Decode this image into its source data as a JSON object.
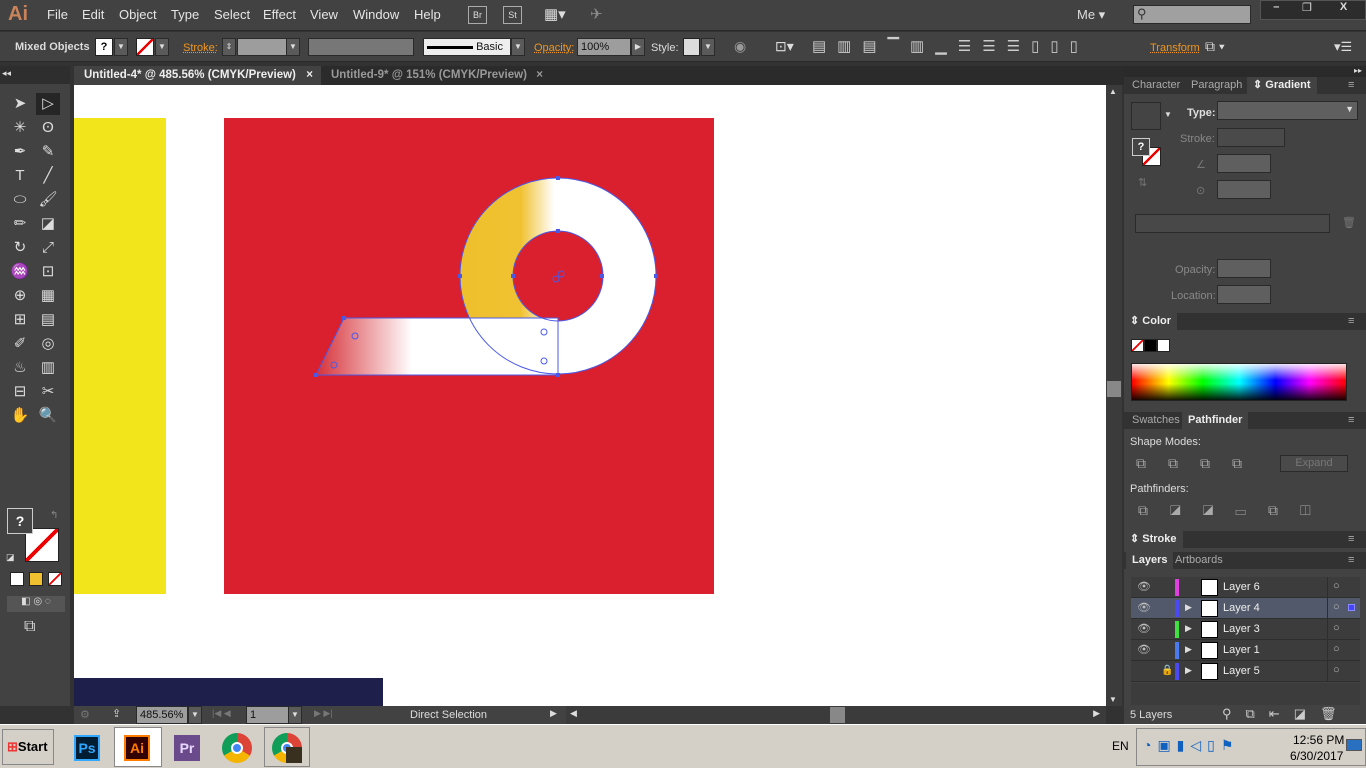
{
  "app": {
    "logo": "Ai",
    "menus": [
      "File",
      "Edit",
      "Object",
      "Type",
      "Select",
      "Effect",
      "View",
      "Window",
      "Help"
    ],
    "bridge": "Br",
    "stock": "St",
    "user": "Me",
    "search_placeholder": ""
  },
  "window_controls": {
    "minimize": "–",
    "restore": "❐",
    "close": "X"
  },
  "control_bar": {
    "selection": "Mixed Objects",
    "fill": "?",
    "stroke_label": "Stroke:",
    "brush": "Basic",
    "opacity_label": "Opacity:",
    "opacity": "100%",
    "style_label": "Style:",
    "transform": "Transform"
  },
  "tabs": [
    {
      "label": "Untitled-4* @ 485.56% (CMYK/Preview)",
      "active": true
    },
    {
      "label": "Untitled-9* @ 151% (CMYK/Preview)",
      "active": false
    }
  ],
  "tools": [
    "selection-tool",
    "direct-selection-tool",
    "magic-wand-tool",
    "lasso-tool",
    "pen-tool",
    "curvature-tool",
    "type-tool",
    "line-tool",
    "ellipse-tool",
    "paintbrush-tool",
    "pencil-tool",
    "eraser-tool",
    "rotate-tool",
    "scale-tool",
    "warp-tool",
    "free-transform-tool",
    "shape-builder-tool",
    "perspective-grid-tool",
    "mesh-tool",
    "gradient-tool",
    "eyedropper-tool",
    "blend-tool",
    "symbol-sprayer-tool",
    "column-graph-tool",
    "artboard-tool",
    "slice-tool",
    "hand-tool",
    "zoom-tool"
  ],
  "tool_glyphs": [
    "➤",
    "▷",
    "✳",
    "ʘ",
    "✒",
    "✎",
    "T",
    "╱",
    "⬭",
    "🖌",
    "✏",
    "◪",
    "↻",
    "⤢",
    "♒",
    "⊡",
    "⊕",
    "▦",
    "⊞",
    "▤",
    "✐",
    "◎",
    "♨",
    "▥",
    "⊟",
    "✂",
    "✋",
    "🔍"
  ],
  "status": {
    "zoom": "485.56%",
    "artboard": "1",
    "tool": "Direct Selection"
  },
  "panels": {
    "top_tabs": [
      "Character",
      "Paragraph",
      "Gradient"
    ],
    "gradient": {
      "type_label": "Type:",
      "stroke_label": "Stroke:",
      "opacity_label": "Opacity:",
      "location_label": "Location:",
      "fill": "?"
    },
    "color": {
      "title": "Color"
    },
    "mid_tabs": [
      "Swatches",
      "Pathfinder"
    ],
    "pathfinder": {
      "shape_modes": "Shape Modes:",
      "expand": "Expand",
      "pathfinders": "Pathfinders:"
    },
    "stroke": {
      "title": "Stroke"
    },
    "layer_tabs": [
      "Layers",
      "Artboards"
    ],
    "layers": [
      {
        "name": "Layer 6",
        "visible": true,
        "locked": false,
        "color": "#e040e0",
        "expandable": false,
        "selected": false
      },
      {
        "name": "Layer 4",
        "visible": true,
        "locked": false,
        "color": "#4a4af0",
        "expandable": true,
        "selected": true
      },
      {
        "name": "Layer 3",
        "visible": true,
        "locked": false,
        "color": "#40e040",
        "expandable": true,
        "selected": false
      },
      {
        "name": "Layer 1",
        "visible": true,
        "locked": false,
        "color": "#4a7af0",
        "expandable": true,
        "selected": false
      },
      {
        "name": "Layer 5",
        "visible": false,
        "locked": true,
        "color": "#4a4af0",
        "expandable": true,
        "selected": false
      }
    ],
    "layer_count": "5 Layers"
  },
  "taskbar": {
    "start": "Start",
    "apps": [
      "Ps",
      "Ai",
      "Pr",
      "Chrome",
      "Chrome"
    ],
    "lang": "EN",
    "time": "12:56 PM",
    "date": "6/30/2017"
  },
  "colors": {
    "red": "#da1f2e",
    "yellow": "#f2e51b",
    "navy": "#1e1f4a",
    "accent": "#f0961e"
  }
}
